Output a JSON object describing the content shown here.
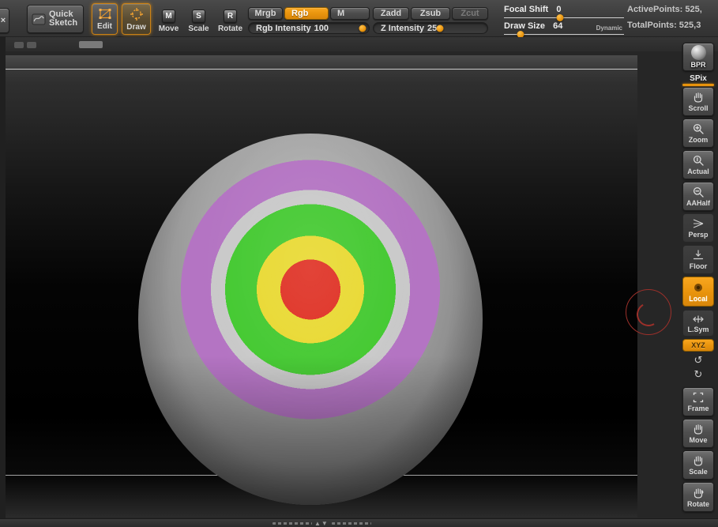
{
  "icons": {
    "close": "×",
    "rotate_ccw": "↺",
    "rotate_cw": "↻",
    "nav_up": "▲",
    "nav_down": "▼"
  },
  "colors": {
    "accent_orange": "#e8930c",
    "cursor_red": "#9c302a"
  },
  "toolbar": {
    "quick_sketch_label": "Quick Sketch",
    "edit_label": "Edit",
    "draw_label": "Draw",
    "move_icon_letter": "M",
    "move_label": "Move",
    "scale_icon_letter": "S",
    "scale_label": "Scale",
    "rotate_icon_letter": "R",
    "rotate_label": "Rotate",
    "mrgb_label": "Mrgb",
    "rgb_label": "Rgb",
    "m_label": "M",
    "zadd_label": "Zadd",
    "zsub_label": "Zsub",
    "zcut_label": "Zcut",
    "rgb_intensity": {
      "label": "Rgb Intensity",
      "value": "100",
      "percent": 95
    },
    "z_intensity": {
      "label": "Z Intensity",
      "value": "25",
      "percent": 58
    },
    "focal_shift": {
      "label": "Focal Shift",
      "value": "0",
      "percent": 47
    },
    "draw_size": {
      "label": "Draw Size",
      "value": "64",
      "percent": 14
    },
    "dynamic_label": "Dynamic",
    "active_points": "ActivePoints: 525,",
    "total_points": "TotalPoints: 525,3"
  },
  "sidebar": {
    "items": [
      {
        "label": "BPR"
      },
      {
        "label": "SPix"
      },
      {
        "label": "Scroll"
      },
      {
        "label": "Zoom"
      },
      {
        "label": "Actual"
      },
      {
        "label": "AAHalf"
      },
      {
        "label": "Persp"
      },
      {
        "label": "Floor"
      },
      {
        "label": "Local",
        "active": true
      },
      {
        "label": "L.Sym"
      },
      {
        "label": "XYZ",
        "active": true
      },
      {
        "label": "Frame"
      },
      {
        "label": "Move"
      },
      {
        "label": "Scale"
      },
      {
        "label": "Rotate"
      }
    ]
  },
  "canvas": {
    "cursor_color": "#9c302a",
    "sphere": {
      "base_color": "#9a9a9a",
      "rings": [
        {
          "color": "#df2f22",
          "radius": 38
        },
        {
          "color": "#e9d930",
          "radius": 68
        },
        {
          "color": "#43c930",
          "radius": 108
        },
        {
          "color": "#c9c9c9",
          "radius": 126
        },
        {
          "color": "#b474c3",
          "radius": 164
        }
      ]
    }
  }
}
